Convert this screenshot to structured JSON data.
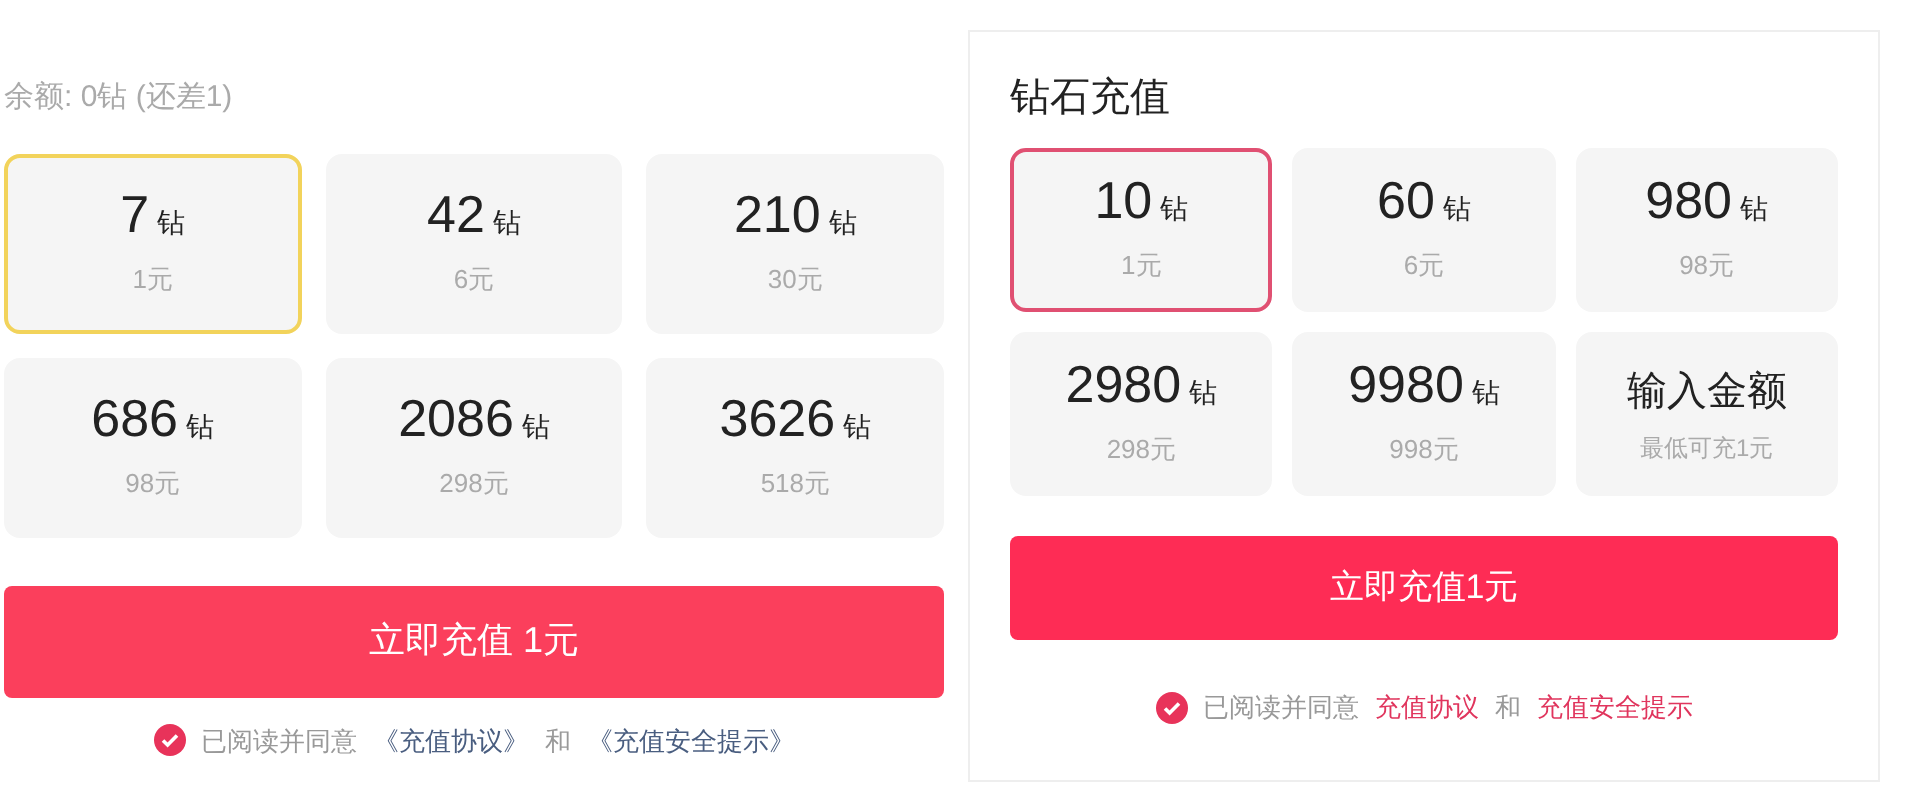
{
  "left_panel": {
    "balance": "余额: 0钻 (还差1)",
    "options": [
      {
        "kind": "package",
        "amount": "7",
        "unit": "钻",
        "price": "1元",
        "selected": true
      },
      {
        "kind": "package",
        "amount": "42",
        "unit": "钻",
        "price": "6元",
        "selected": false
      },
      {
        "kind": "package",
        "amount": "210",
        "unit": "钻",
        "price": "30元",
        "selected": false
      },
      {
        "kind": "package",
        "amount": "686",
        "unit": "钻",
        "price": "98元",
        "selected": false
      },
      {
        "kind": "package",
        "amount": "2086",
        "unit": "钻",
        "price": "298元",
        "selected": false
      },
      {
        "kind": "package",
        "amount": "3626",
        "unit": "钻",
        "price": "518元",
        "selected": false
      }
    ],
    "button": "立即充值 1元",
    "agreement": {
      "checked": true,
      "text": "已阅读并同意",
      "link_1": "《充值协议》",
      "conjunction": "和",
      "link_2": "《充值安全提示》"
    }
  },
  "right_panel": {
    "title": "钻石充值",
    "options": [
      {
        "kind": "package",
        "amount": "10",
        "unit": "钻",
        "price": "1元",
        "selected": true
      },
      {
        "kind": "package",
        "amount": "60",
        "unit": "钻",
        "price": "6元",
        "selected": false
      },
      {
        "kind": "package",
        "amount": "980",
        "unit": "钻",
        "price": "98元",
        "selected": false
      },
      {
        "kind": "package",
        "amount": "2980",
        "unit": "钻",
        "price": "298元",
        "selected": false
      },
      {
        "kind": "package",
        "amount": "9980",
        "unit": "钻",
        "price": "998元",
        "selected": false
      },
      {
        "kind": "custom",
        "label": "输入金额",
        "hint": "最低可充1元",
        "selected": false
      }
    ],
    "button": "立即充值1元",
    "agreement": {
      "checked": true,
      "text": "已阅读并同意",
      "link_1": "充值协议",
      "conjunction": "和",
      "link_2": "充值安全提示"
    }
  }
}
